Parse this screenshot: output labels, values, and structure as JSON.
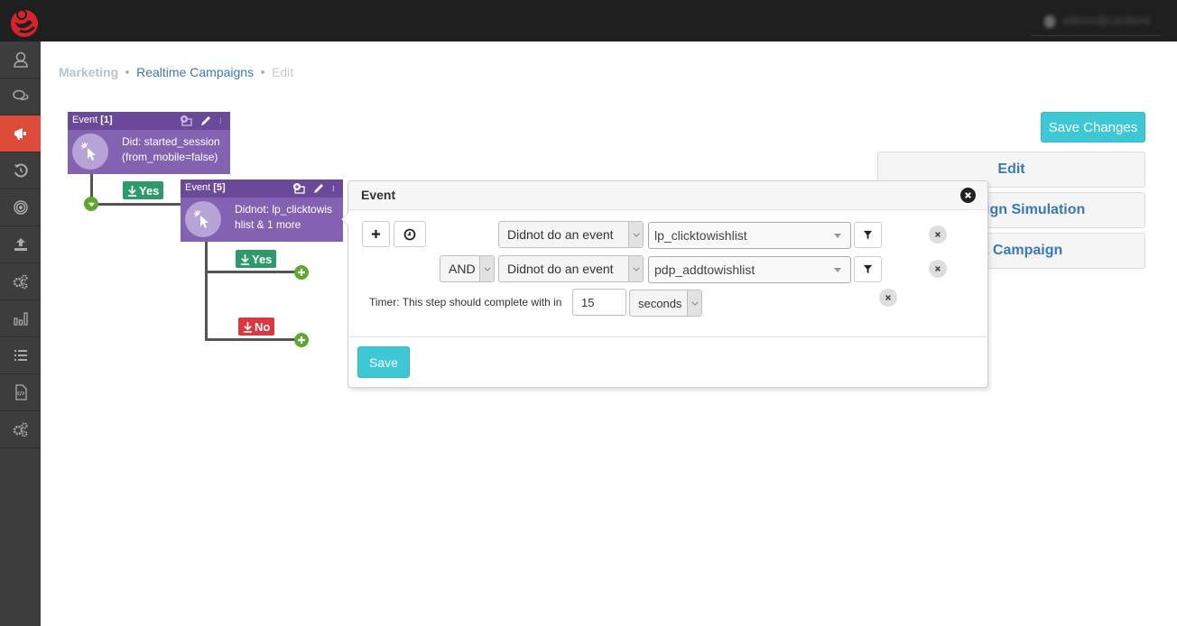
{
  "topbar": {
    "logo": "brand-logo",
    "user_label": "admin@cardone",
    "user_obscured": true
  },
  "sidebar": {
    "items": [
      {
        "icon": "user-icon",
        "active": false
      },
      {
        "icon": "chat-icon",
        "active": false
      },
      {
        "icon": "megaphone-icon",
        "active": true
      },
      {
        "icon": "history-icon",
        "active": false
      },
      {
        "icon": "target-icon",
        "active": false
      },
      {
        "icon": "upload-icon",
        "active": false
      },
      {
        "icon": "gears-icon",
        "active": false
      },
      {
        "icon": "bar-chart-icon",
        "active": false
      },
      {
        "icon": "list-icon",
        "active": false
      },
      {
        "icon": "code-file-icon",
        "active": false
      },
      {
        "icon": "settings-gears-icon",
        "active": false
      }
    ],
    "active_color": "#dd4b39"
  },
  "breadcrumb": {
    "root": "Marketing",
    "link": "Realtime Campaigns",
    "current": "Edit"
  },
  "actions": {
    "save_changes": "Save Changes",
    "edit": "Edit",
    "campaign_simulation": "Campaign Simulation",
    "test_campaign": "Test Campaign"
  },
  "flow": {
    "node1": {
      "title": "Event",
      "index": "[1]",
      "line1": "Did: started_session",
      "line2": "(from_mobile=false)"
    },
    "node1_branch": {
      "label": "Yes"
    },
    "node2": {
      "title": "Event",
      "index": "[5]",
      "line1": "Didnot: lp_clicktowis",
      "line2": "hlist & 1 more"
    },
    "node2_yes": {
      "label": "Yes"
    },
    "node2_no": {
      "label": "No"
    }
  },
  "popover": {
    "title": "Event",
    "row1": {
      "condition": "Didnot do an event",
      "event": "lp_clicktowishlist"
    },
    "row2": {
      "operator": "AND",
      "condition": "Didnot do an event",
      "event": "pdp_addtowishlist"
    },
    "timer": {
      "label": "Timer: This step should complete with in",
      "value": "15",
      "unit": "seconds"
    },
    "save": "Save"
  }
}
